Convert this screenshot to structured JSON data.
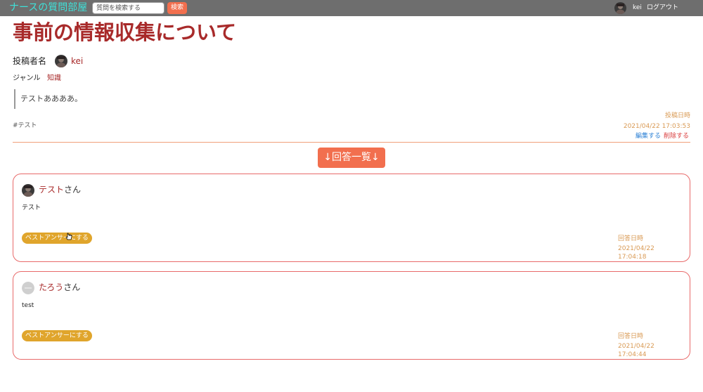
{
  "navbar": {
    "brand": "ナースの質問部屋",
    "search_placeholder": "質問を検索する",
    "search_button": "検索",
    "user_name": "kei",
    "logout": "ログアウト"
  },
  "question": {
    "title": "事前の情報収集について",
    "author_label": "投稿者名",
    "author_name": "kei",
    "genre_label": "ジャンル",
    "genre_value": "知識",
    "body": "テストああああ。",
    "tag": "#テスト",
    "posted_label": "投稿日時",
    "posted_date": "2021/04/22 17:03:53",
    "edit_link": "編集する",
    "delete_link": "削除する"
  },
  "answers_heading": "↓回答一覧↓",
  "answers": [
    {
      "name": "テスト",
      "honorific": "さん",
      "body": "テスト",
      "best_button": "ベストアンサーにする",
      "date_label": "回答日時",
      "date": "2021/04/22 17:04:18"
    },
    {
      "name": "たろう",
      "honorific": "さん",
      "body": "test",
      "best_button": "ベストアンサーにする",
      "date_label": "回答日時",
      "date": "2021/04/22 17:04:44"
    }
  ],
  "colors": {
    "navbar_bg": "#6e6e6e",
    "brand": "#3fe0d8",
    "accent_orange": "#f26f4e",
    "title_red": "#a82a2a",
    "date_gold": "#d99a54",
    "best_button": "#e0a52c",
    "edit_blue": "#2a7fd4",
    "delete_red": "#d93a3a"
  }
}
